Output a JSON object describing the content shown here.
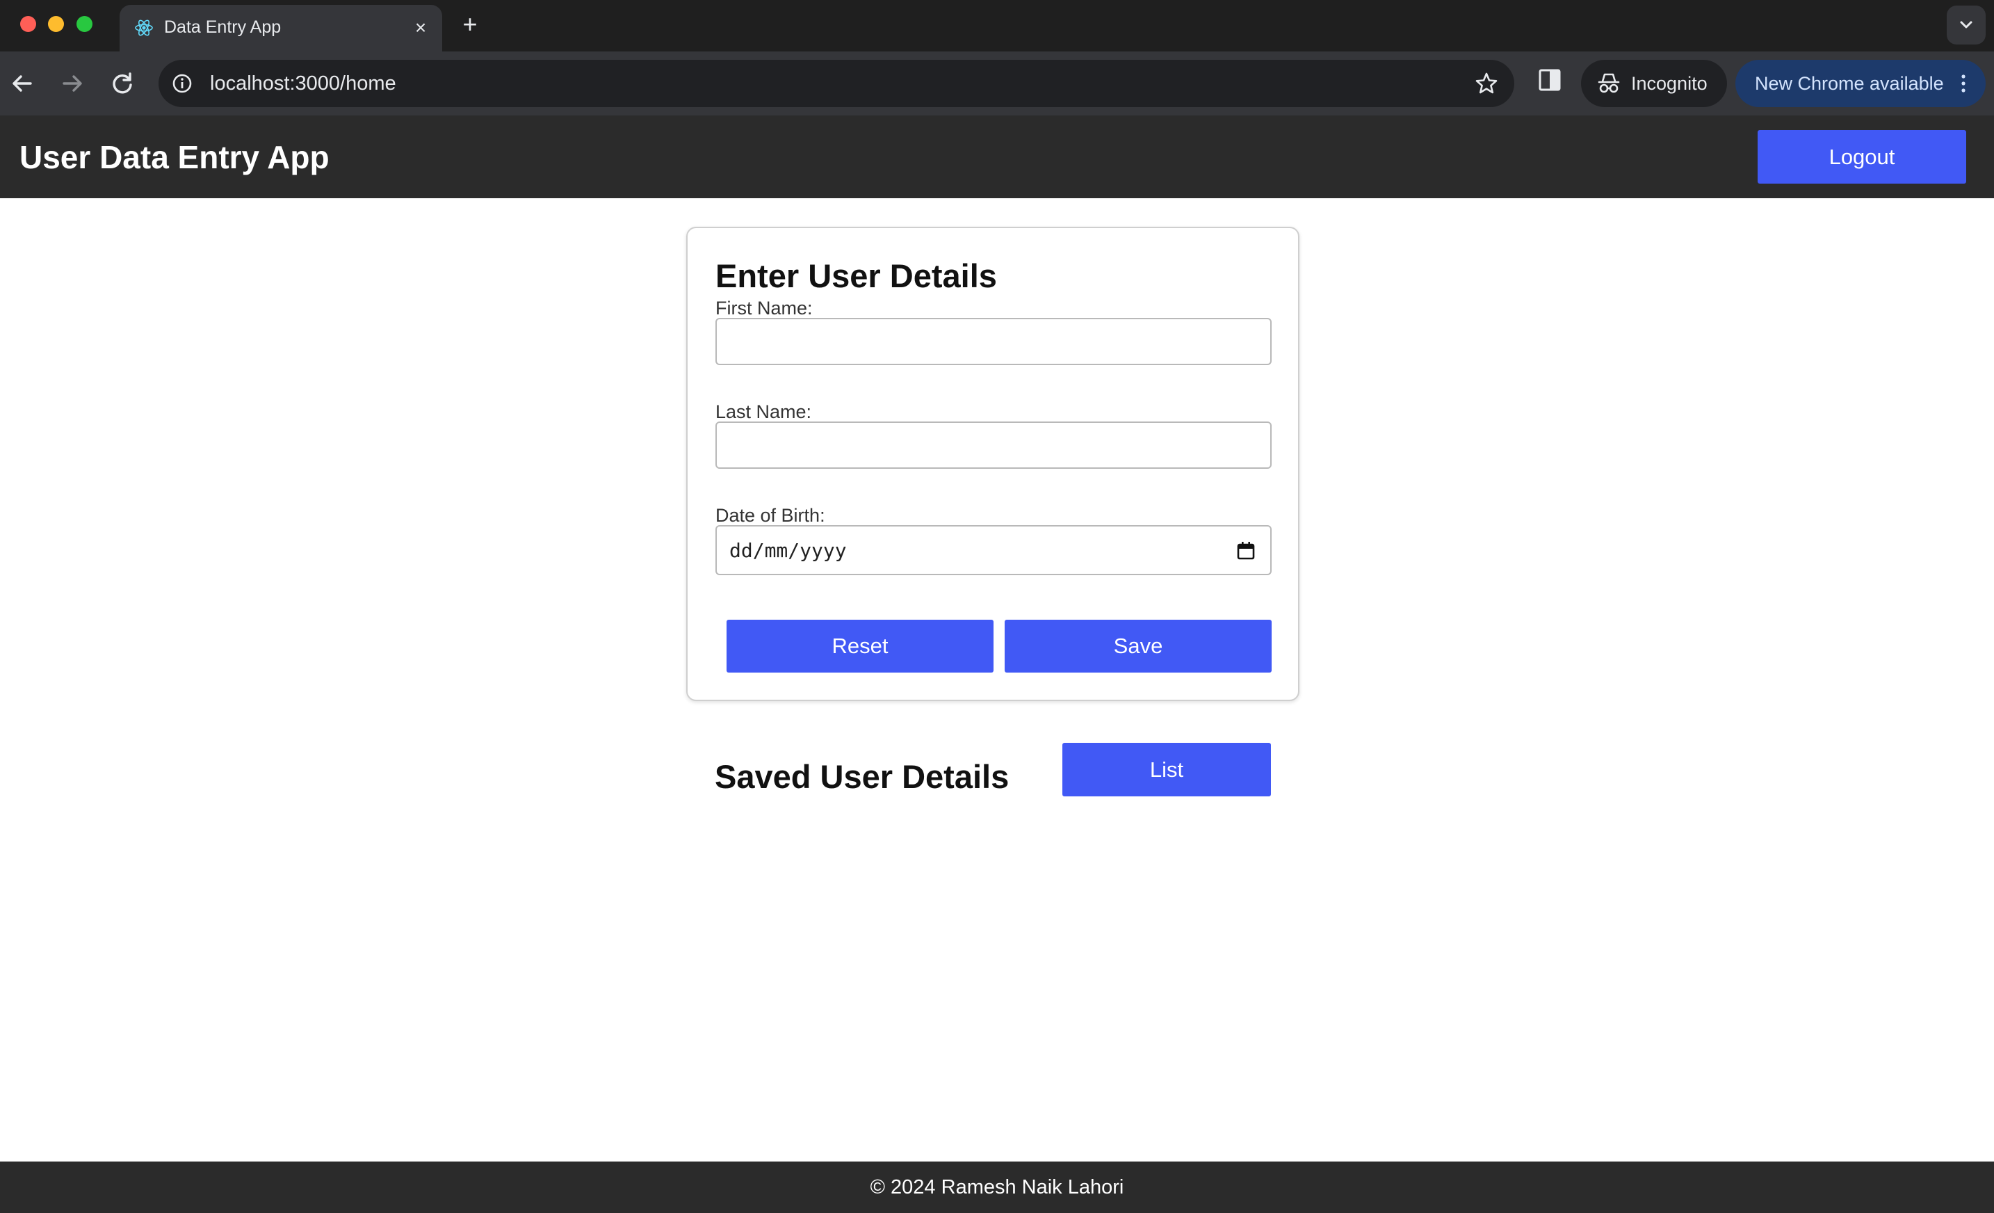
{
  "browser": {
    "tab_title": "Data Entry App",
    "tab_close": "×",
    "new_tab": "+",
    "url": "localhost:3000/home",
    "incognito_label": "Incognito",
    "update_label": "New Chrome available",
    "favicon": "react-icon"
  },
  "header": {
    "title": "User Data Entry App",
    "logout_label": "Logout"
  },
  "form": {
    "title": "Enter User Details",
    "first_name_label": "First Name:",
    "first_name_value": "",
    "last_name_label": "Last Name:",
    "last_name_value": "",
    "dob_label": "Date of Birth:",
    "dob_placeholder": "dd/mm/yyyy",
    "reset_label": "Reset",
    "save_label": "Save"
  },
  "saved": {
    "title": "Saved User Details",
    "list_label": "List"
  },
  "footer": {
    "text": "© 2024 Ramesh Naik Lahori"
  },
  "colors": {
    "accent": "#4159f5",
    "header_bg": "#2b2b2b",
    "chrome_bg": "#202124"
  }
}
